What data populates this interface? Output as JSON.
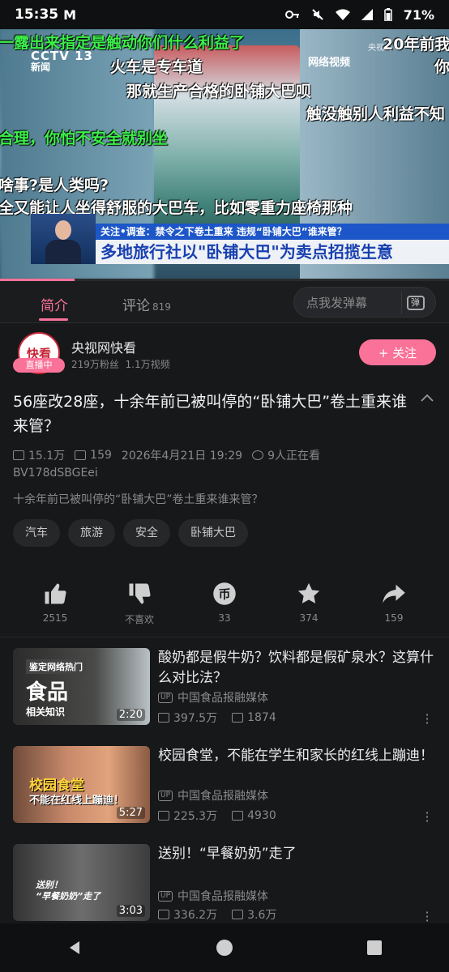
{
  "status_bar": {
    "time": "15:35",
    "m_icon": "M",
    "battery": "71%"
  },
  "video": {
    "channel_logo": "CCTV 13",
    "channel_sub": "新闻",
    "source_label": "网络视频",
    "corner_label": "央视网",
    "danmaku": [
      "一露出来指定是触动你们什么利益了",
      "火车是专车道",
      "那就生产合格的卧铺大巴呗",
      "合理，你怕不安全就别坐",
      "啥事?是人类吗?",
      "全又能让人坐得舒服的大巴车，比如零重力座椅那种",
      "20年前我",
      "你",
      "触没触别人利益不知"
    ],
    "ticker": "关注•调查：禁令之下卷土重来 违规“卧铺大巴”谁来管？",
    "headline": "多地旅行社以\"卧铺大巴\"为卖点招揽生意",
    "progress": 0.166
  },
  "tabs": {
    "intro": "简介",
    "comments": "评论",
    "comments_count": "819",
    "danmaku_placeholder": "点我发弹幕",
    "danmaku_btn": "弹"
  },
  "uploader": {
    "avatar_text": "快看",
    "live": "直播中",
    "name": "央视网快看",
    "fans": "219万粉丝",
    "videos": "1.1万视频",
    "follow": "+ 关注"
  },
  "video_info": {
    "title": "56座改28座，十余年前已被叫停的“卧铺大巴”卷土重来谁来管？",
    "views": "15.1万",
    "danmaku_count": "159",
    "date": "2026年4月21日 19:29",
    "watching": "9人正在看",
    "bv": "BV178dSBGEei",
    "description": "十余年前已被叫停的“卧铺大巴”卷土重来谁来管？",
    "tags": [
      "汽车",
      "旅游",
      "安全",
      "卧铺大巴"
    ]
  },
  "actions": [
    {
      "icon": "thumbs-up-icon",
      "label": "2515"
    },
    {
      "icon": "thumbs-down-icon",
      "label": "不喜欢"
    },
    {
      "icon": "coin-icon",
      "label": "33"
    },
    {
      "icon": "star-icon",
      "label": "374"
    },
    {
      "icon": "share-icon",
      "label": "159"
    }
  ],
  "related": [
    {
      "title": "酸奶都是假牛奶？饮料都是假矿泉水？这算什么对比法？",
      "thumb_text": "鉴定网络热门",
      "thumb_big": "食品",
      "thumb_sub": "相关知识",
      "duration": "2:20",
      "up_badge": "UP",
      "channel": "中国食品报融媒体",
      "views": "397.5万",
      "danmaku": "1874"
    },
    {
      "title": "校园食堂，不能在学生和家长的红线上蹦迪！",
      "thumb_text": "校园食堂",
      "thumb_big": "不能在红线上蹦迪！",
      "thumb_sub": "",
      "duration": "5:27",
      "up_badge": "UP",
      "channel": "中国食品报融媒体",
      "views": "225.3万",
      "danmaku": "4930"
    },
    {
      "title": "送别！“早餐奶奶”走了",
      "thumb_text": "送别！",
      "thumb_big": "“早餐奶奶”走了",
      "thumb_sub": "",
      "duration": "3:03",
      "up_badge": "UP",
      "channel": "中国食品报融媒体",
      "views": "336.2万",
      "danmaku": "3.6万"
    }
  ],
  "colors": {
    "accent": "#fb7299",
    "background": "#17181a"
  }
}
